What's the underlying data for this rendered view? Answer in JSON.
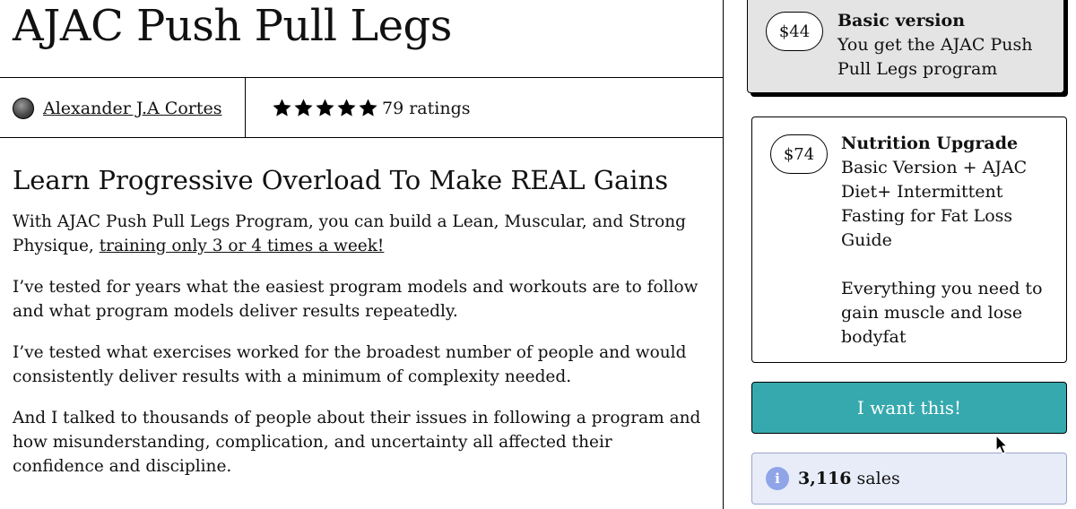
{
  "product": {
    "title": "AJAC Push Pull Legs",
    "author_name": "Alexander J.A Cortes",
    "rating_stars": 5,
    "rating_text": "79 ratings"
  },
  "description": {
    "headline": "Learn Progressive Overload To Make REAL Gains",
    "p1_text": "With AJAC Push Pull Legs Program, you can build a Lean, Muscular, and Strong Physique, ",
    "p1_link": "training only 3 or 4 times a week!",
    "p2": "I’ve tested for years what the easiest program models and workouts are to follow and what program models deliver results repeatedly.",
    "p3": "I’ve tested what exercises worked for the broadest number of people and would consistently deliver results with a minimum of complexity needed.",
    "p4": "And I talked to thousands of people about their issues in following a program and how misunderstanding, complication, and uncertainty all affected their confidence and discipline."
  },
  "options": {
    "basic": {
      "price": "$44",
      "name": "Basic version",
      "desc": "You get the AJAC Push Pull Legs program"
    },
    "nutrition": {
      "price": "$74",
      "name": "Nutrition Upgrade",
      "desc": "Basic Version + AJAC Diet+ Intermittent Fasting for Fat Loss Guide",
      "desc2": "Everything you need to gain muscle and lose bodyfat"
    }
  },
  "buy_button": {
    "label": "I want this!"
  },
  "sales": {
    "icon_glyph": "i",
    "count": "3,116",
    "label": "sales"
  },
  "colors": {
    "buy_button_bg": "#36a9ae",
    "selected_option_bg": "#e4e4e4",
    "sales_box_bg": "#e8ecf9",
    "info_icon": "#90a4e8"
  },
  "icons": {
    "avatar": "author-avatar",
    "star": "star-icon",
    "info": "info-icon",
    "cursor": "mouse-cursor-icon"
  }
}
